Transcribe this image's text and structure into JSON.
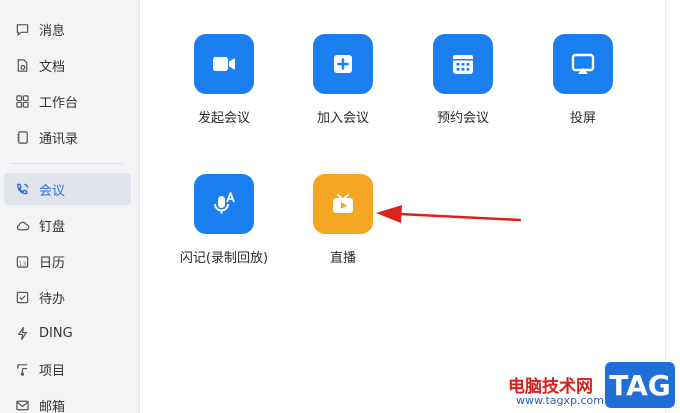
{
  "sidebar": {
    "items": [
      {
        "label": "消息",
        "icon": "chat-icon",
        "active": false
      },
      {
        "label": "文档",
        "icon": "document-icon",
        "active": false
      },
      {
        "label": "工作台",
        "icon": "grid-icon",
        "active": false
      },
      {
        "label": "通讯录",
        "icon": "contacts-icon",
        "active": false
      },
      {
        "label": "会议",
        "icon": "phone-icon",
        "active": true
      },
      {
        "label": "钉盘",
        "icon": "cloud-icon",
        "active": false
      },
      {
        "label": "日历",
        "icon": "calendar-icon",
        "active": false
      },
      {
        "label": "待办",
        "icon": "checkbox-icon",
        "active": false
      },
      {
        "label": "DING",
        "icon": "lightning-icon",
        "active": false
      },
      {
        "label": "项目",
        "icon": "project-icon",
        "active": false
      },
      {
        "label": "邮箱",
        "icon": "mail-icon",
        "active": false
      }
    ]
  },
  "main": {
    "tiles": [
      {
        "label": "发起会议",
        "icon": "video-camera-icon",
        "color": "#1a7ff0"
      },
      {
        "label": "加入会议",
        "icon": "plus-square-icon",
        "color": "#1a7ff0"
      },
      {
        "label": "预约会议",
        "icon": "calendar-grid-icon",
        "color": "#1a7ff0"
      },
      {
        "label": "投屏",
        "icon": "screen-cast-icon",
        "color": "#1a7ff0"
      },
      {
        "label": "闪记(录制回放)",
        "icon": "microphone-ai-icon",
        "color": "#1a7ff0"
      },
      {
        "label": "直播",
        "icon": "tv-play-icon",
        "color": "#f5a623"
      }
    ]
  },
  "colors": {
    "accent": "#2e6ee6",
    "arrow": "#d9241c"
  },
  "watermark": {
    "text": "电脑技术网",
    "url": "www.tagxp.com",
    "logo": "TAG"
  }
}
